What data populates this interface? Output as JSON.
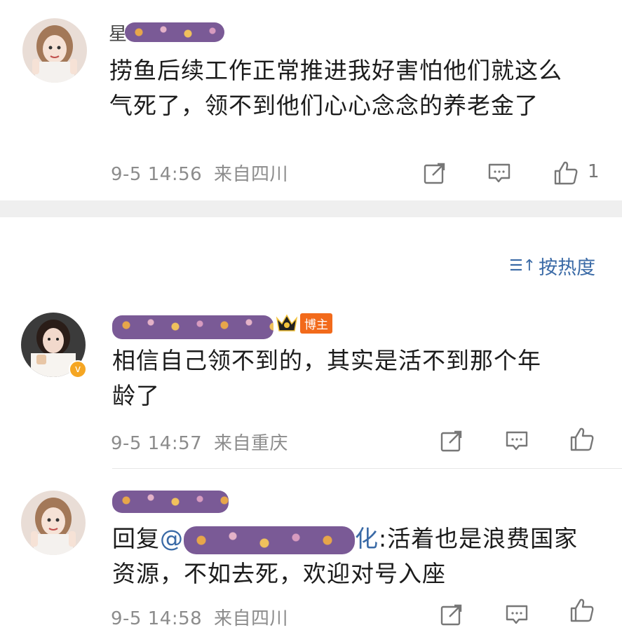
{
  "comments": [
    {
      "name_prefix": "星",
      "text_line1": "捞鱼后续工作正常推进我好害怕他们就这么",
      "text_line2": "气死了，领不到他们心心念念的养老金了",
      "time": "9-5 14:56",
      "location": "来自四川",
      "likes": "1"
    },
    {
      "badge": "博主",
      "text_line1": "相信自己领不到的，其实是活不到那个年",
      "text_line2": "龄了",
      "time": "9-5 14:57",
      "location": "来自重庆"
    },
    {
      "reply_prefix": "回复",
      "mention_at": "@",
      "mention_suffix": "化",
      "text_rest": ":活着也是浪费国家",
      "text_line2": "资源，不如去死，欢迎对号入座",
      "time": "9-5 14:58",
      "location": "来自四川"
    }
  ],
  "sort": {
    "label": "按热度",
    "icon": "sort-icon"
  },
  "icons": {
    "share": "share-icon",
    "comment": "comment-icon",
    "like": "thumbs-up-icon"
  },
  "colors": {
    "accent_blue": "#3a6aa6",
    "blogger_orange": "#f26a1b",
    "redaction_purple": "#7a5a96",
    "divider_gray": "#efefef"
  }
}
